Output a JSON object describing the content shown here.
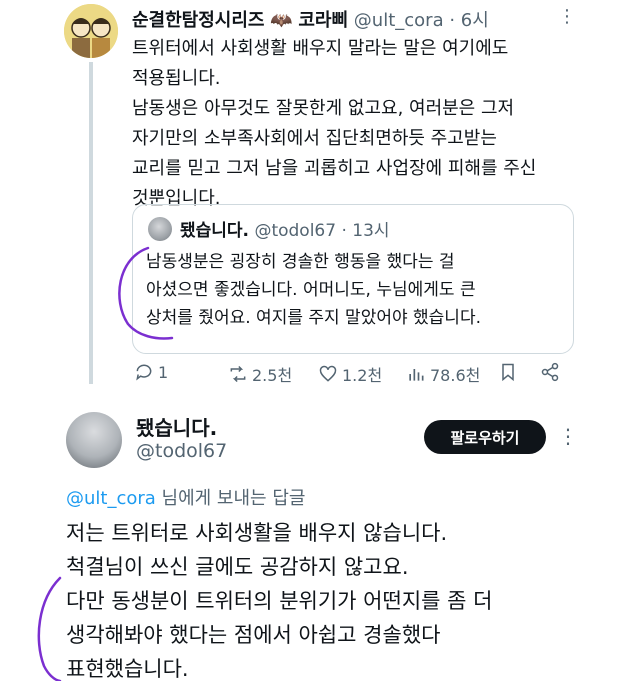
{
  "tweet": {
    "author_name": "순결한탐정시리즈",
    "author_badge": "🦇",
    "author_name2": "코라삐",
    "handle": "@ult_cora",
    "time": "· 6시",
    "more": "⋮",
    "body": "트위터에서 사회생활 배우지 말라는 말은 여기에도\n적용됩니다.\n남동생은 아무것도 잘못한게 없고요, 여러분은 그저\n자기만의 소부족사회에서 집단최면하듯 주고받는\n교리를 믿고 그저 남을 괴롭히고 사업장에 피해를 주신\n것뿐입니다.",
    "quote": {
      "author_name": "됐습니다.",
      "handle": "@todol67",
      "time": "· 13시",
      "body": "남동생분은 굉장히 경솔한 행동을 했다는 걸\n아셨으면 좋겠습니다. 어머니도, 누님에게도 큰\n상처를 줬어요.  여지를 주지 말았어야 했습니다."
    },
    "actions": {
      "replies": "1",
      "retweets": "2.5천",
      "likes": "1.2천",
      "views": "78.6천"
    }
  },
  "reply": {
    "author_name": "됐습니다.",
    "handle": "@todol67",
    "follow_label": "팔로우하기",
    "more": "⋮",
    "replying_handle": "@ult_cora",
    "replying_suffix": " 님에게 보내는 답글",
    "body": "저는 트위터로 사회생활을 배우지 않습니다.\n척결님이 쓰신 글에도 공감하지 않고요.\n다만 동생분이 트위터의 분위기가 어떤지를 좀 더\n생각해봐야 했다는 점에서 아쉽고 경솔했다\n표현했습니다."
  },
  "colors": {
    "accent": "#1d9bf0",
    "muted": "#536471",
    "annotation": "#7b2fd0"
  }
}
